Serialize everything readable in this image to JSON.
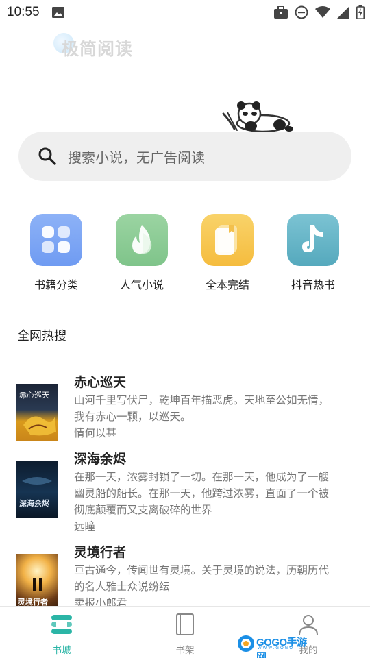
{
  "status_bar": {
    "time": "10:55",
    "icons": [
      "image-icon",
      "briefcase-icon",
      "do-not-disturb-icon",
      "wifi-icon",
      "signal-icon",
      "battery-charging-icon"
    ]
  },
  "header": {
    "logo_text": "极简阅读"
  },
  "search": {
    "placeholder": "搜索小说，无广告阅读"
  },
  "categories": [
    {
      "label": "书籍分类",
      "icon": "grid-icon",
      "color": "#6f9bf2"
    },
    {
      "label": "人气小说",
      "icon": "flame-icon",
      "color": "#7fc48a"
    },
    {
      "label": "全本完结",
      "icon": "book-icon",
      "color": "#f5c04a"
    },
    {
      "label": "抖音热书",
      "icon": "tiktok-icon",
      "color": "#5fb0c2"
    }
  ],
  "hot_section": {
    "title": "全网热搜"
  },
  "books": [
    {
      "title": "赤心巡天",
      "desc_lines": [
        "山河千里写伏尸，乾坤百年描恶虎。天地至公如无情，",
        "我有赤心一颗，以巡天。"
      ],
      "author": "情何以甚",
      "cover_text": "赤心巡天"
    },
    {
      "title": "深海余烬",
      "desc_lines": [
        "在那一天，浓雾封锁了一切。在那一天，他成为了一艘",
        "幽灵船的船长。在那一天，他跨过浓雾，直面了一个被",
        "彻底颠覆而又支离破碎的世界"
      ],
      "author": "远瞳",
      "cover_text": "深海余烬"
    },
    {
      "title": "灵境行者",
      "desc_lines": [
        "亘古通今，传闻世有灵境。关于灵境的说法，历朝历代",
        "的名人雅士众说纷纭"
      ],
      "author": "卖报小郎君",
      "cover_text": "灵境行者"
    }
  ],
  "bottom_nav": {
    "items": [
      {
        "label": "书城",
        "icon": "bookstore-icon",
        "active": true
      },
      {
        "label": "书架",
        "icon": "bookshelf-icon",
        "active": false
      },
      {
        "label": "我的",
        "icon": "profile-icon",
        "active": false
      }
    ]
  },
  "watermark": {
    "text": "GOGO手游网",
    "sub": "WWW.GOGO"
  },
  "colors": {
    "accent": "#2bb5a6",
    "search_bg": "#efefef",
    "text_secondary": "#777777"
  }
}
